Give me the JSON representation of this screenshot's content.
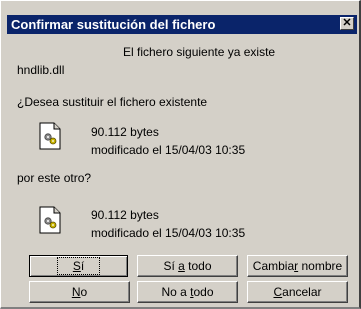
{
  "window": {
    "title": "Confirmar sustitución del fichero",
    "close_glyph": "✕"
  },
  "message": {
    "header": "El fichero siguiente ya existe",
    "filename": "hndlib.dll",
    "question": "¿Desea sustituir el fichero existente",
    "existing": {
      "size": "90.112 bytes",
      "modified": "modificado el 15/04/03 10:35",
      "icon": "dll-file-icon"
    },
    "replace_prompt": "por este otro?",
    "new": {
      "size": "90.112 bytes",
      "modified": "modificado el 15/04/03 10:35",
      "icon": "dll-file-icon"
    }
  },
  "buttons": {
    "yes": {
      "pre": "",
      "key": "S",
      "post": "í"
    },
    "yes_all": {
      "pre": "Sí ",
      "key": "a",
      "post": " todo"
    },
    "rename": {
      "pre": "Cambia",
      "key": "r",
      "post": " nombre"
    },
    "no": {
      "pre": "",
      "key": "N",
      "post": "o"
    },
    "no_all": {
      "pre": "No a ",
      "key": "t",
      "post": "odo"
    },
    "cancel": {
      "pre": "",
      "key": "C",
      "post": "ancelar"
    }
  }
}
